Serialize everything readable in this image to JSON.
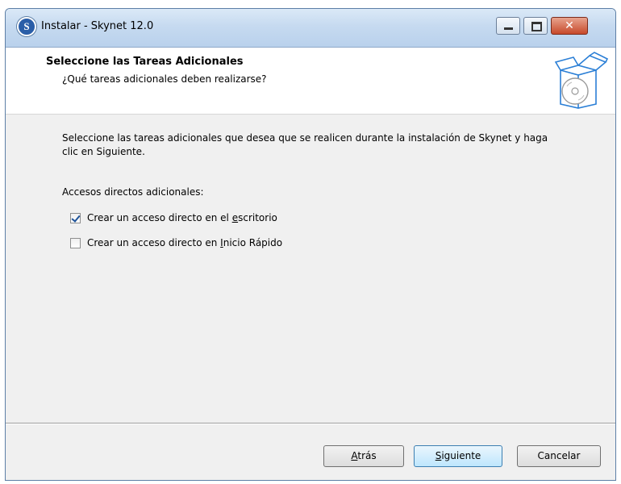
{
  "window": {
    "title": "Instalar - Skynet 12.0",
    "icon_letter": "S",
    "close_glyph": "✕",
    "icons": [
      "app-icon",
      "minimize-icon",
      "maximize-icon",
      "close-icon",
      "installer-box-icon"
    ]
  },
  "header": {
    "title": "Seleccione las Tareas Adicionales",
    "subtitle": "¿Qué tareas adicionales deben realizarse?"
  },
  "body": {
    "instructions": "Seleccione las tareas adicionales que desea que se realicen durante la instalación de Skynet y haga clic en Siguiente.",
    "group_label": "Accesos directos adicionales:",
    "tasks": [
      {
        "label_pre": "Crear un acceso directo en el ",
        "label_key": "e",
        "label_post": "scritorio",
        "checked": true
      },
      {
        "label_pre": "Crear un acceso directo en ",
        "label_key": "I",
        "label_post": "nicio Rápido",
        "checked": false
      }
    ]
  },
  "buttons": {
    "back": {
      "key": "A",
      "rest": "trás"
    },
    "next": {
      "key": "S",
      "rest": "iguiente"
    },
    "cancel": "Cancelar"
  },
  "colors": {
    "accent": "#3c7fb1",
    "title_bar": "#c6daf0",
    "close": "#c7492b"
  }
}
